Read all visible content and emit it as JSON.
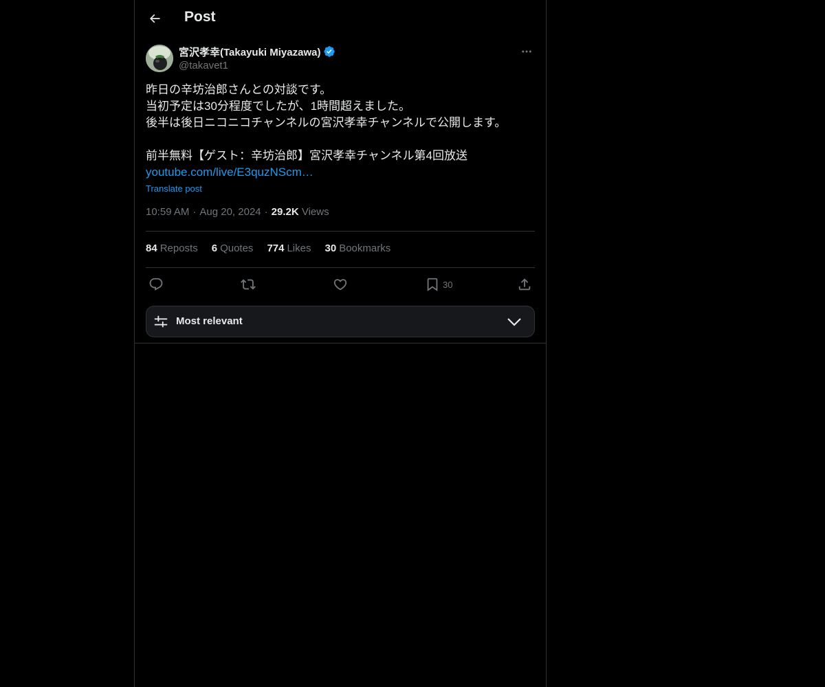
{
  "header": {
    "title": "Post"
  },
  "post": {
    "author": {
      "display_name": "宮沢孝幸(Takayuki Miyazawa)",
      "handle": "@takavet1",
      "verified": true
    },
    "body_lines": [
      "昨日の辛坊治郎さんとの対談です。",
      "当初予定は30分程度でしたが、1時間超えました。",
      "後半は後日ニコニコチャンネルの宮沢孝幸チャンネルで公開します。",
      "",
      "前半無料【ゲスト：辛坊治郎】宮沢孝幸チャンネル第4回放送"
    ],
    "link_text": "youtube.com/live/E3quzNScm…",
    "translate_label": "Translate post",
    "time": "10:59 AM",
    "date": "Aug 20, 2024",
    "views_count": "29.2K",
    "views_label": "Views",
    "separator": "·"
  },
  "stats": {
    "reposts_count": "84",
    "reposts_label": "Reposts",
    "quotes_count": "6",
    "quotes_label": "Quotes",
    "likes_count": "774",
    "likes_label": "Likes",
    "bookmarks_count": "30",
    "bookmarks_label": "Bookmarks"
  },
  "actions": {
    "bookmark_count": "30"
  },
  "sort": {
    "label": "Most relevant"
  },
  "colors": {
    "background": "#000000",
    "text": "#e7e9ea",
    "muted": "#71767b",
    "accent": "#1d9bf0",
    "border": "#2f3336"
  }
}
